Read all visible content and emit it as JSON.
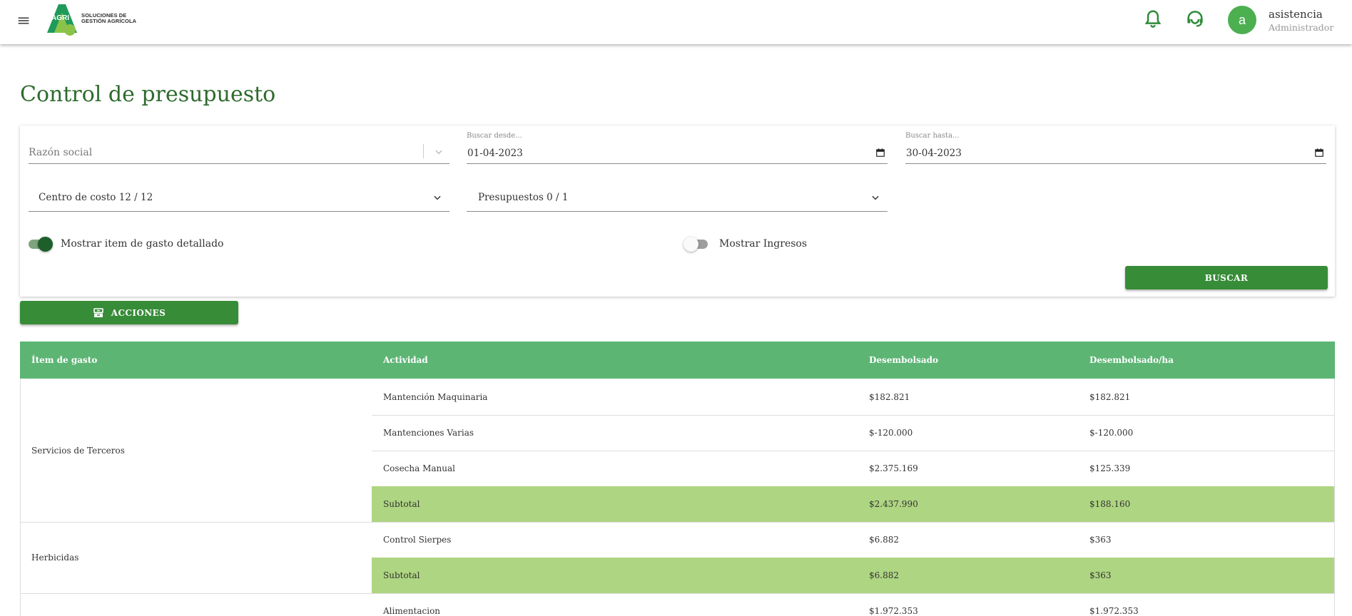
{
  "header": {
    "logo_mark": "AGRI",
    "logo_line1": "SOLUCIONES DE",
    "logo_line2": "GESTIÓN AGRÍCOLA",
    "user_initial": "a",
    "user_name": "asistencia",
    "user_role": "Administrador",
    "accent": "#4caf50"
  },
  "page": {
    "title": "Control de presupuesto"
  },
  "filters": {
    "razon_social_placeholder": "Razón social",
    "desde_label": "Buscar desde...",
    "desde_value": "01-04-2023",
    "hasta_label": "Buscar hasta...",
    "hasta_value": "30-04-2023",
    "centro_costo": "Centro de costo 12 / 12",
    "presupuestos": "Presupuestos 0 / 1",
    "toggle_detalle_label": "Mostrar item de gasto detallado",
    "toggle_detalle_on": true,
    "toggle_ingresos_label": "Mostrar Ingresos",
    "toggle_ingresos_on": false,
    "buscar_label": "BUSCAR"
  },
  "actions": {
    "label": "ACCIONES"
  },
  "table": {
    "headers": [
      "Ítem de gasto",
      "Actividad",
      "Desembolsado",
      "Desembolsado/ha"
    ],
    "groups": [
      {
        "item": "Servicios de Terceros",
        "rows": [
          {
            "actividad": "Mantención Maquinaria",
            "desembolsado": "$182.821",
            "desembolsado_ha": "$182.821"
          },
          {
            "actividad": "Mantenciones Varias",
            "desembolsado": "$-120.000",
            "desembolsado_ha": "$-120.000"
          },
          {
            "actividad": "Cosecha Manual",
            "desembolsado": "$2.375.169",
            "desembolsado_ha": "$125.339"
          },
          {
            "actividad": "Subtotal",
            "desembolsado": "$2.437.990",
            "desembolsado_ha": "$188.160",
            "subtotal": true
          }
        ]
      },
      {
        "item": "Herbicidas",
        "rows": [
          {
            "actividad": "Control Sierpes",
            "desembolsado": "$6.882",
            "desembolsado_ha": "$363"
          },
          {
            "actividad": "Subtotal",
            "desembolsado": "$6.882",
            "desembolsado_ha": "$363",
            "subtotal": true
          }
        ]
      },
      {
        "item": "",
        "rows": [
          {
            "actividad": "Alimentacion",
            "desembolsado": "$1.972.353",
            "desembolsado_ha": "$1.972.353"
          }
        ]
      }
    ]
  }
}
